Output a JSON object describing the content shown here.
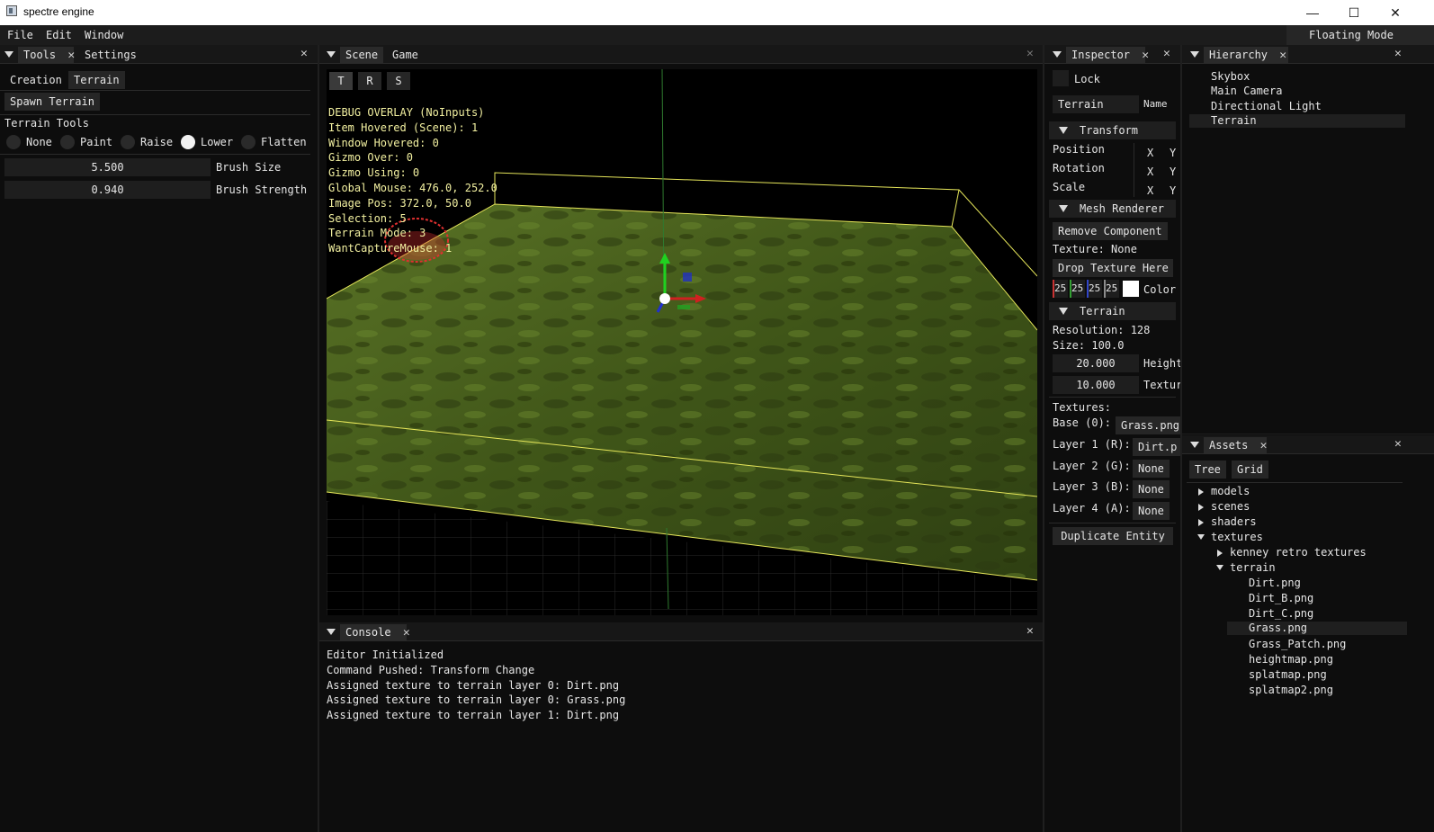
{
  "window": {
    "title": "spectre engine",
    "minimize": "—",
    "maximize": "☐",
    "close": "✕"
  },
  "menubar": {
    "items": [
      "File",
      "Edit",
      "Window"
    ],
    "floating_mode": "Floating Mode"
  },
  "tools_panel": {
    "tabs": [
      "Tools",
      "Settings"
    ],
    "subtabs": [
      "Creation",
      "Terrain"
    ],
    "spawn_button": "Spawn Terrain",
    "section_label": "Terrain Tools",
    "modes": [
      {
        "label": "None",
        "selected": false
      },
      {
        "label": "Paint",
        "selected": false
      },
      {
        "label": "Raise",
        "selected": false
      },
      {
        "label": "Lower",
        "selected": true
      },
      {
        "label": "Flatten",
        "selected": false
      }
    ],
    "brush_size": {
      "value": "5.500",
      "label": "Brush Size"
    },
    "brush_strength": {
      "value": "0.940",
      "label": "Brush Strength"
    }
  },
  "scene_panel": {
    "tabs": [
      "Scene",
      "Game"
    ],
    "gizmo_buttons": [
      "T",
      "R",
      "S"
    ],
    "debug_overlay": [
      "DEBUG OVERLAY (NoInputs)",
      "Item Hovered (Scene): 1",
      "Window Hovered: 0",
      "Gizmo Over: 0",
      "Gizmo Using: 0",
      "Global Mouse: 476.0, 252.0",
      "Image Pos: 372.0, 50.0",
      "Selection: 5",
      "Terrain Mode: 3",
      "WantCaptureMouse: 1"
    ]
  },
  "console_panel": {
    "tab": "Console",
    "lines": [
      "Editor Initialized",
      "Command Pushed: Transform Change",
      "Assigned texture to terrain layer 0: Dirt.png",
      "Assigned texture to terrain layer 0: Grass.png",
      "Assigned texture to terrain layer 1: Dirt.png"
    ]
  },
  "inspector_panel": {
    "tab": "Inspector",
    "lock_label": "Lock",
    "name_value": "Terrain",
    "name_label": "Name",
    "transform": {
      "header": "Transform",
      "rows": [
        "Position",
        "Rotation",
        "Scale"
      ],
      "axis_x": "X",
      "axis_y": "Y"
    },
    "mesh_renderer": {
      "header": "Mesh Renderer",
      "remove_button": "Remove Component",
      "texture_text": "Texture: None",
      "drop_button": "Drop Texture Here",
      "color_values": [
        "25",
        "25!",
        "25",
        "25!"
      ],
      "color_label": "Color",
      "channel_colors": [
        "#c83232",
        "#32a032",
        "#3246c8",
        "#8c8c8c"
      ]
    },
    "terrain": {
      "header": "Terrain",
      "resolution": "Resolution: 128",
      "size": "Size: 100.0",
      "height_value": "20.000",
      "height_label": "Height",
      "texture_scale_value": "10.000",
      "texture_scale_label": "Textur",
      "textures_label": "Textures:",
      "layers": [
        {
          "label": "Base (0):",
          "value": "Grass.png"
        },
        {
          "label": "Layer 1 (R):",
          "value": "Dirt.p"
        },
        {
          "label": "Layer 2 (G):",
          "value": "None"
        },
        {
          "label": "Layer 3 (B):",
          "value": "None"
        },
        {
          "label": "Layer 4 (A):",
          "value": "None"
        }
      ]
    },
    "duplicate_button": "Duplicate Entity"
  },
  "hierarchy_panel": {
    "tab": "Hierarchy",
    "items": [
      {
        "label": "Skybox",
        "selected": false
      },
      {
        "label": "Main Camera",
        "selected": false
      },
      {
        "label": "Directional Light",
        "selected": false
      },
      {
        "label": "Terrain",
        "selected": true
      }
    ]
  },
  "assets_panel": {
    "tab": "Assets",
    "view_buttons": [
      "Tree",
      "Grid"
    ],
    "tree": [
      {
        "label": "models",
        "depth": 0,
        "expanded": false,
        "folder": true
      },
      {
        "label": "scenes",
        "depth": 0,
        "expanded": false,
        "folder": true
      },
      {
        "label": "shaders",
        "depth": 0,
        "expanded": false,
        "folder": true
      },
      {
        "label": "textures",
        "depth": 0,
        "expanded": true,
        "folder": true
      },
      {
        "label": "kenney retro textures",
        "depth": 1,
        "expanded": false,
        "folder": true
      },
      {
        "label": "terrain",
        "depth": 1,
        "expanded": true,
        "folder": true
      },
      {
        "label": "Dirt.png",
        "depth": 2,
        "folder": false
      },
      {
        "label": "Dirt_B.png",
        "depth": 2,
        "folder": false
      },
      {
        "label": "Dirt_C.png",
        "depth": 2,
        "folder": false
      },
      {
        "label": "Grass.png",
        "depth": 2,
        "folder": false,
        "selected": true
      },
      {
        "label": "Grass_Patch.png",
        "depth": 2,
        "folder": false
      },
      {
        "label": "heightmap.png",
        "depth": 2,
        "folder": false
      },
      {
        "label": "splatmap.png",
        "depth": 2,
        "folder": false
      },
      {
        "label": "splatmap2.png",
        "depth": 2,
        "folder": false
      }
    ]
  },
  "colors": {
    "panel_bg": "#0d0d0d",
    "tab_active": "#2a2a2a",
    "overlay_text": "#f2f0a0",
    "terrain_green": "#4a5f1c",
    "bounds_yellow": "#e6e65a"
  }
}
